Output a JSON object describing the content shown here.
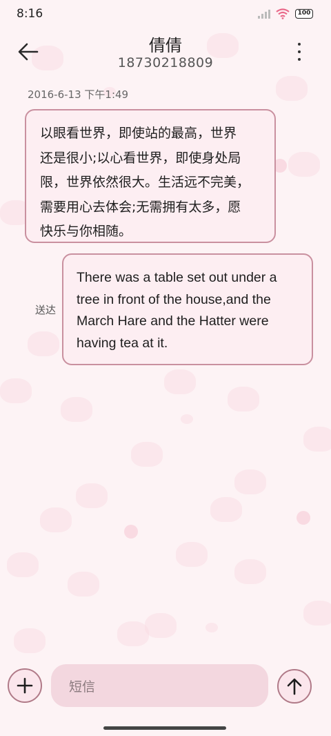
{
  "status": {
    "time": "8:16",
    "battery": "100"
  },
  "header": {
    "contact_name": "倩倩",
    "phone": "18730218809"
  },
  "conversation": {
    "timestamp": "2016-6-13 下午1:49",
    "incoming_lines": [
      "以眼看世界，即使站的最高，世界",
      "还是很小;以心看世界，即使身处局",
      "限，世界依然很大。生活远不完美，",
      "需要用心去体会;无需拥有太多，愿",
      "快乐与你相随。"
    ],
    "outgoing_lines": [
      "There was a table set out under a",
      "tree in front of the house,and the",
      "March Hare and the Hatter were",
      "having tea at it."
    ],
    "outgoing_status": "送达"
  },
  "composer": {
    "placeholder": "短信"
  },
  "icons": {
    "back": "arrow-left-icon",
    "menu": "more-vertical-icon",
    "add": "plus-icon",
    "send": "arrow-up-icon",
    "signal": "signal-icon",
    "wifi": "wifi-icon",
    "battery": "battery-icon"
  },
  "colors": {
    "background": "#fdf3f5",
    "bubble": "#fdeef2",
    "bubble_border": "#c9909f",
    "input": "#f3d7df"
  }
}
